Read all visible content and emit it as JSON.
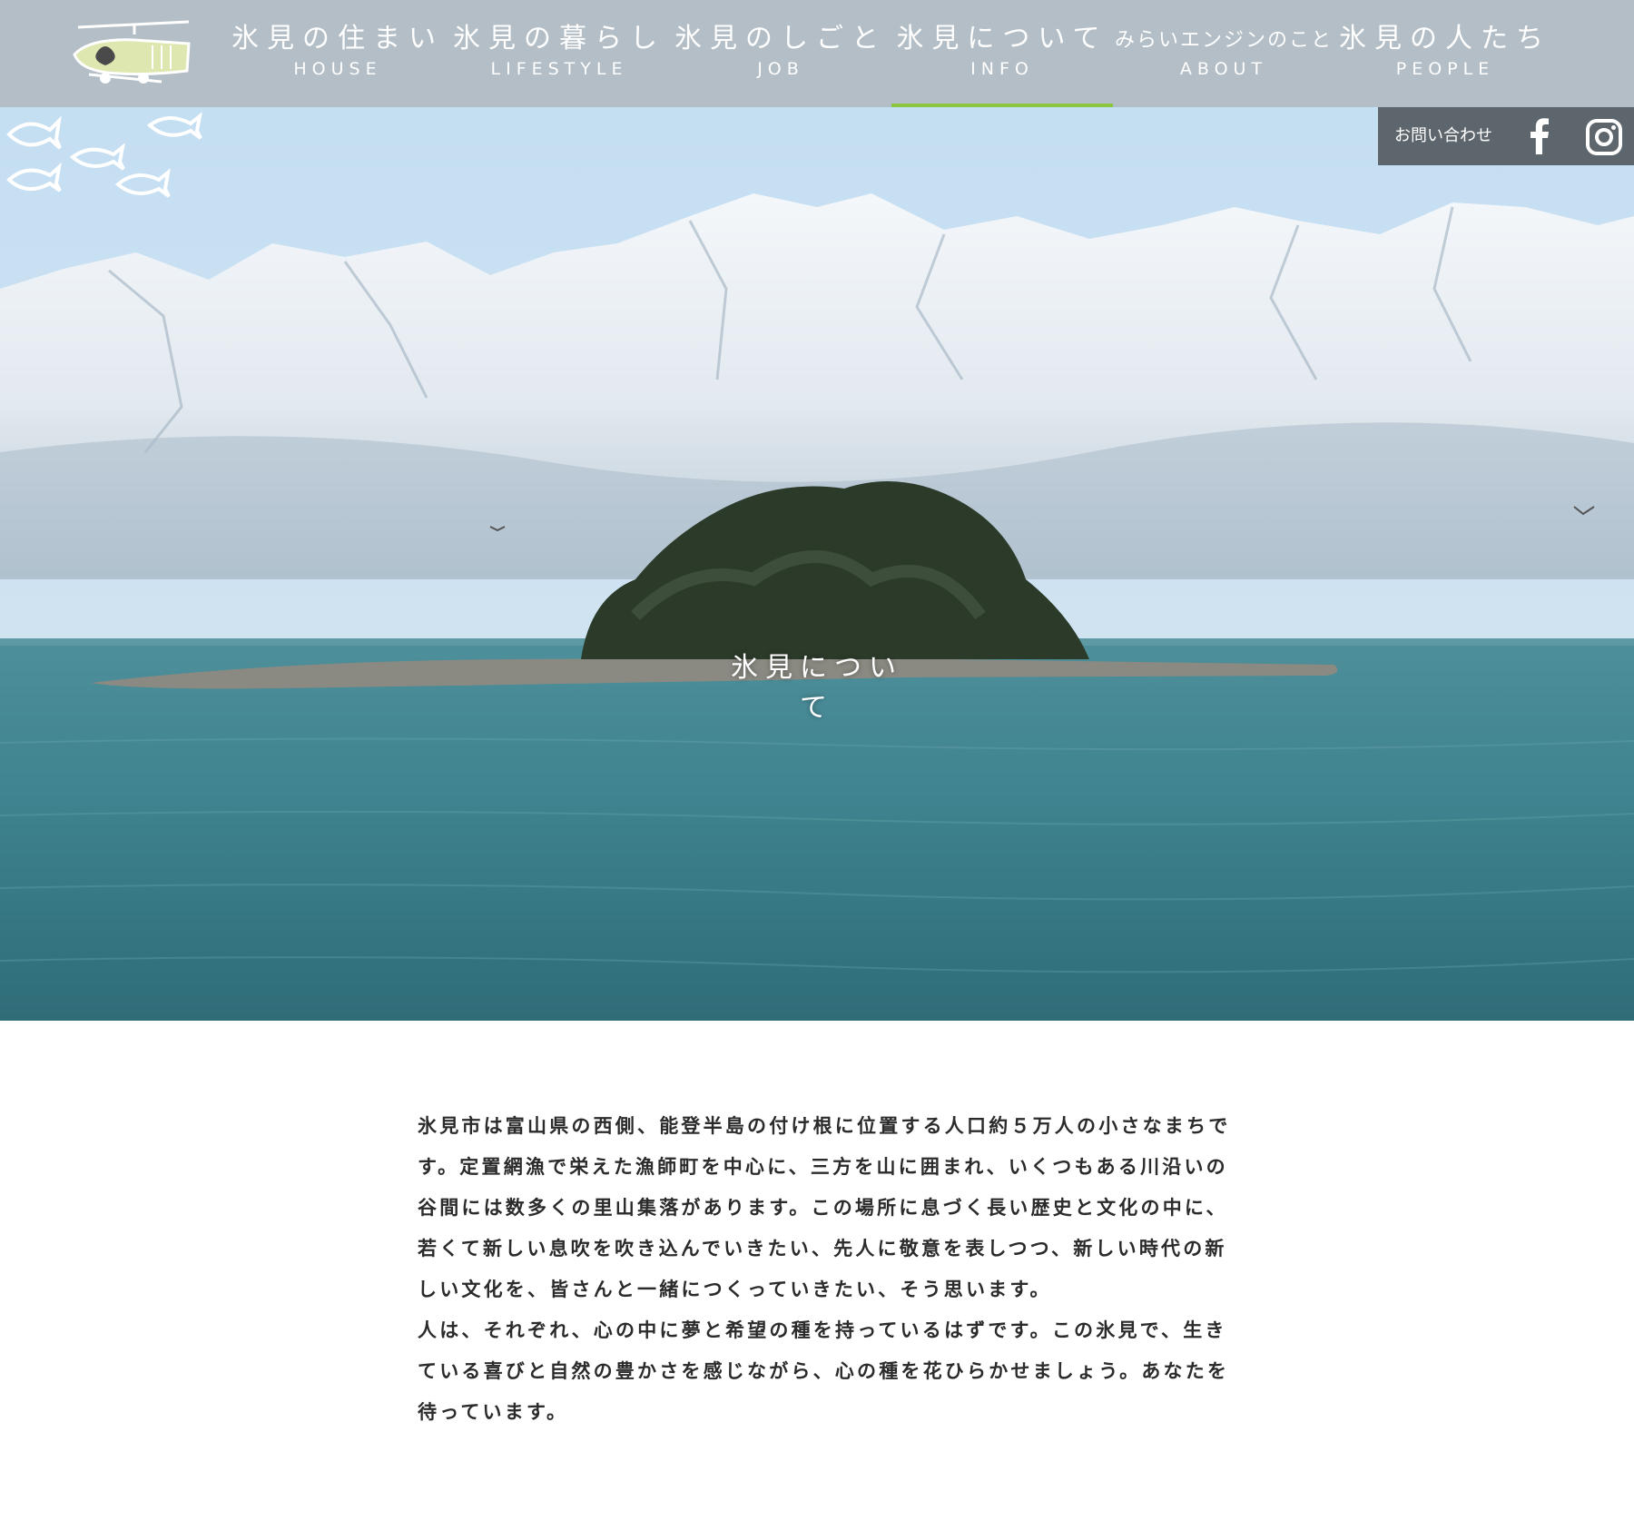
{
  "header": {
    "nav": [
      {
        "jp": "氷見の住まい",
        "en": "HOUSE",
        "active": false
      },
      {
        "jp": "氷見の暮らし",
        "en": "LIFESTYLE",
        "active": false
      },
      {
        "jp": "氷見のしごと",
        "en": "JOB",
        "active": false
      },
      {
        "jp": "氷見について",
        "en": "INFO",
        "active": true
      },
      {
        "jp": "みらいエンジンのこと",
        "en": "ABOUT",
        "active": false
      },
      {
        "jp": "氷見の人たち",
        "en": "PEOPLE",
        "active": false
      }
    ],
    "active_color": "#8cc63f"
  },
  "contact_bar": {
    "contact_label": "お問い合わせ",
    "icons": [
      "facebook-icon",
      "instagram-icon"
    ]
  },
  "hero": {
    "title": "氷見について",
    "emblem_icon": "fish-school-icon"
  },
  "intro": {
    "paragraphs": [
      "氷見市は富山県の西側、能登半島の付け根に位置する人口約５万人の小さなまちです。定置網漁で栄えた漁師町を中心に、三方を山に囲まれ、いくつもある川沿いの谷間には数多くの里山集落があります。この場所に息づく長い歴史と文化の中に、若くて新しい息吹を吹き込んでいきたい、先人に敬意を表しつつ、新しい時代の新しい文化を、皆さんと一緒につくっていきたい、そう思います。",
      "人は、それぞれ、心の中に夢と希望の種を持っているはずです。この氷見で、生きている喜びと自然の豊かさを感じながら、心の種を花ひらかせましょう。あなたを待っています。"
    ]
  }
}
